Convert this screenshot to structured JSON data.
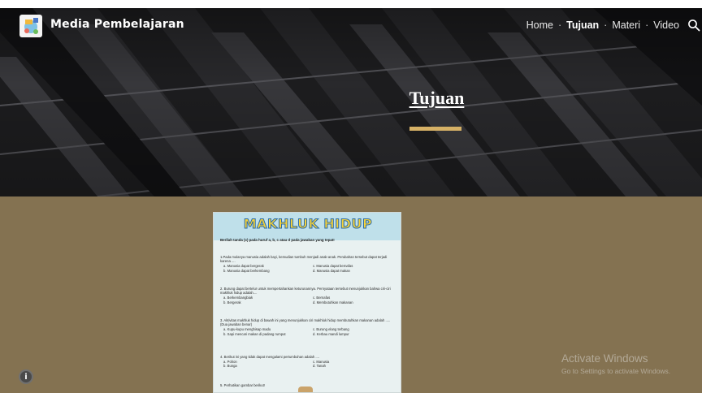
{
  "site": {
    "title": "Media Pembelajaran"
  },
  "nav": {
    "items": [
      {
        "label": "Home"
      },
      {
        "label": "Tujuan"
      },
      {
        "label": "Materi"
      },
      {
        "label": "Video"
      }
    ],
    "separator": "·",
    "active": "Tujuan"
  },
  "hero": {
    "title": "Tujuan"
  },
  "worksheet": {
    "title": "MAKHLUK HIDUP",
    "instruction": "Berilah tanda (x) pada huruf a, b, c atau d pada jawaban yang tepat!",
    "questions": [
      {
        "text": "1.Pada mulanya manusia adalah bayi, kemudian tumbuh menjadi anak-anak. Perubahan tersebut dapat terjadi karena ....",
        "options": [
          "a. Manusia dapat bergerak",
          "c. Manusia dapat bernafas",
          "b. Manusia dapat berkembang",
          "d. Manusia dapat makan"
        ]
      },
      {
        "text": "2. Burung dapat bertelur untuk mempertahankan keturunannya. Pernyataan tersebut menunjukkan bahwa ciri-ciri makhluk hidup adalah....",
        "options": [
          "a. Berkembangbiak",
          "c. Bernafas",
          "b. Bergerak",
          "d. Membutuhkan makanan"
        ]
      },
      {
        "text": "3. Aktivitas makhluk hidup di bawah ini yang menunjukkan ciri makhluk hidup membutuhkan makanan adalah ..... (Dua jawaban benar)",
        "options": [
          "a. Kupu-kupu menghisap madu",
          "c. Burung elang terbang",
          "b. Sapi mencari makan di padang rumput",
          "d. Kerbau mandi lumpur"
        ]
      },
      {
        "text": "4. Berikut ini yang tidak dapat mengalami pertumbuhan adalah ....",
        "options": [
          "a. Pohon",
          "c. Manusia",
          "b. Bunga",
          "d. Tanah"
        ]
      },
      {
        "text": "5. Perhatikan gambar berikut!",
        "options": []
      }
    ]
  },
  "watermark": {
    "title": "Activate Windows",
    "subtitle": "Go to Settings to activate Windows."
  },
  "colors": {
    "hero_background": "#1e1e20",
    "accent": "#d6b166",
    "content_background": "#847251"
  },
  "icons": {
    "logo": "learning-media-logo",
    "search": "search-icon",
    "info": "info-icon"
  }
}
